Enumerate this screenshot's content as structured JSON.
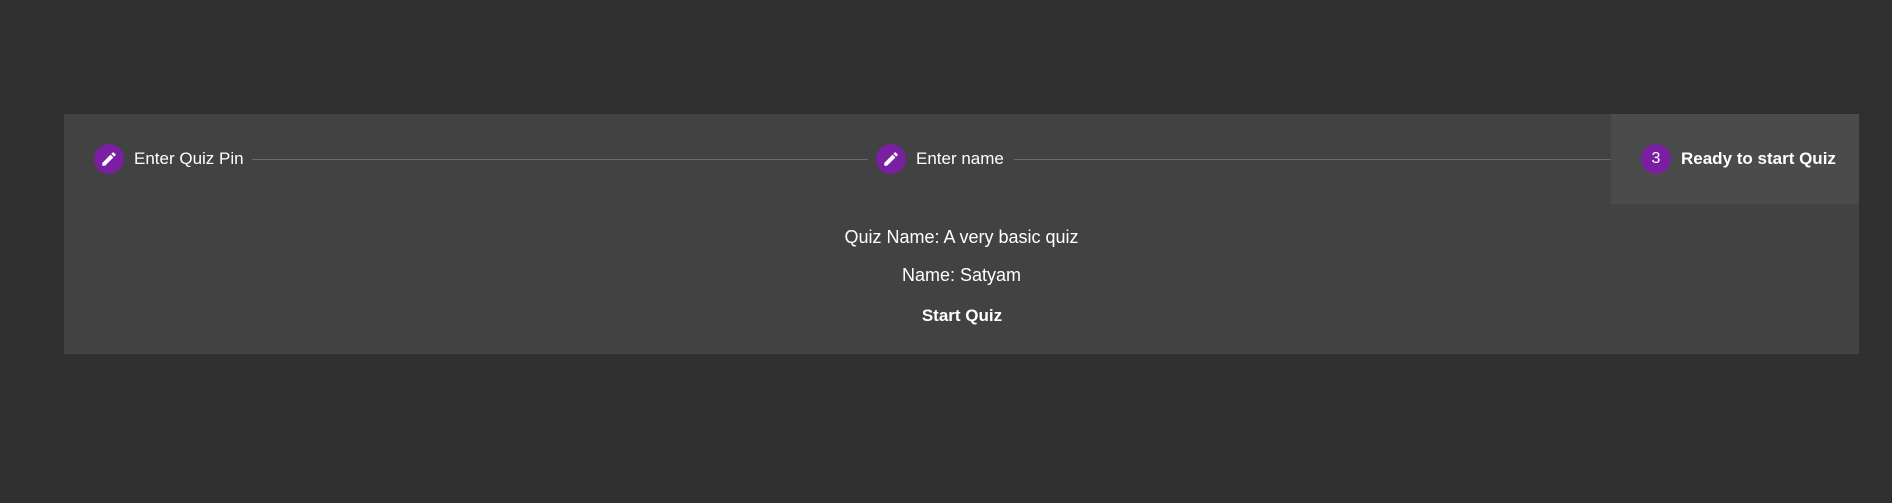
{
  "stepper": {
    "steps": [
      {
        "label": "Enter Quiz Pin",
        "icon": "pencil-icon",
        "state": "completed"
      },
      {
        "label": "Enter name",
        "icon": "pencil-icon",
        "state": "completed"
      },
      {
        "label": "Ready to start Quiz",
        "number": "3",
        "state": "active"
      }
    ],
    "accent_color": "#7b1fa2"
  },
  "summary": {
    "quiz_name": "Quiz Name: A very basic quiz",
    "player_name": "Name: Satyam"
  },
  "actions": {
    "start_label": "Start Quiz"
  }
}
